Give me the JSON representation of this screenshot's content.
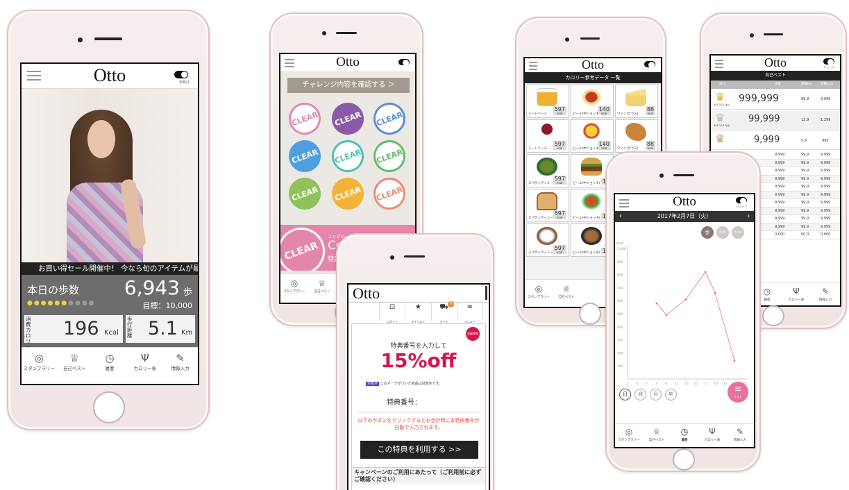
{
  "app": {
    "name": "Otto"
  },
  "phone1": {
    "step_toggle_label": "歩数計",
    "banner": "お買い得セール開催中！ 今なら旬のアイテムが最",
    "today_steps_label": "本日の歩数",
    "steps_value": "6,943",
    "steps_unit": "歩",
    "goal": "目標：10,000",
    "calorie_label": "消費カロリー",
    "calorie_value": "196",
    "calorie_unit": "Kcal",
    "distance_label": "歩行距離",
    "distance_value": "5.1",
    "distance_unit": "Km",
    "tabs": [
      "スタンプラリー",
      "自己ベスト",
      "履歴",
      "カロリー表",
      "情報入力"
    ]
  },
  "phone2": {
    "challenge_button": "チャレンジ内容を確認する ＞",
    "stamp_text": "CLEAR",
    "complete_msg": "コンプリート！おめでとうございます！",
    "complete_prefix": "Co",
    "complete_sub": "特典",
    "tabs": [
      "スタンプラリー",
      "自己ベスト"
    ]
  },
  "phone3": {
    "menu_items": [
      "ログイン",
      "マイリスト",
      "カート",
      "メニュー"
    ],
    "cart_badge": "0",
    "coupon_lead": "特典番号を入力して",
    "coupon_badge": "会員登録",
    "discount": "15%off",
    "mark_note": "このマークがついた商品は対象外です。",
    "mark_label": "対象外",
    "code_label": "特典番号：",
    "notice": "以下のボタンをクリックするとお会計時に本特典番号が自動で入力されます。",
    "use_button": "この特典を利用する >>",
    "campaign_title": "キャンペーンのご利用にあたって（ご利用前に必ずご確認ください）"
  },
  "phone4": {
    "title": "カロリー参考データ 一覧",
    "cells": [
      {
        "name": "ミートソース",
        "value": "597",
        "unit": "kcal"
      },
      {
        "name": "ビール(中ジョッキ)",
        "value": "140",
        "unit": "kcal"
      },
      {
        "name": "ワイン(グラス)",
        "value": "88",
        "unit": "kcal"
      },
      {
        "name": "ミートソース",
        "value": "597",
        "unit": "kcal"
      },
      {
        "name": "ビール(中ジョッキ)",
        "value": "140",
        "unit": "kcal"
      },
      {
        "name": "ワイン(グラス)",
        "value": "88",
        "unit": "kcal"
      },
      {
        "name": "スパゲッティミートソース",
        "value": "597",
        "unit": "kcal"
      },
      {
        "name": "ビール(中ジョッキ)",
        "value": "14",
        "unit": "kcal"
      },
      {
        "name": "スパゲッティミートソース",
        "value": "597",
        "unit": "kcal"
      },
      {
        "name": "ビール(中ジョッキ)",
        "value": "14",
        "unit": "kcal"
      },
      {
        "name": "スパゲッティミートソース",
        "value": "597",
        "unit": "kcal"
      },
      {
        "name": "ビール(中ジョッキ)",
        "value": "14",
        "unit": "kcal"
      }
    ],
    "tabs": [
      "スタンプラリー",
      "自己ベスト"
    ]
  },
  "phone5": {
    "toggle_label": "ショップ",
    "title": "自己ベスト",
    "headers": [
      "日付",
      "歩数",
      "距離km",
      "消費kcal"
    ],
    "top": [
      {
        "date": "2017/2/1(水)",
        "steps": "999,999",
        "dist": "99.9",
        "kcal": "9,999"
      },
      {
        "date": "2017/2/15(水)",
        "steps": "99,999",
        "dist": "12.9",
        "kcal": "1,299"
      },
      {
        "date": "",
        "steps": "9,999",
        "dist": "5.9",
        "kcal": "999"
      }
    ],
    "rows": [
      {
        "steps": "9,999",
        "dist": "99.9",
        "kcal": "9,999"
      },
      {
        "steps": "9,999",
        "dist": "99.9",
        "kcal": "9,999"
      },
      {
        "steps": "9,999",
        "dist": "99.9",
        "kcal": "9,999"
      },
      {
        "steps": "9,999",
        "dist": "99.9",
        "kcal": "9,999"
      },
      {
        "steps": "9,999",
        "dist": "99.9",
        "kcal": "9,999"
      },
      {
        "steps": "9,999",
        "dist": "99.9",
        "kcal": "9,999"
      },
      {
        "steps": "9,999",
        "dist": "99.9",
        "kcal": "9,999"
      },
      {
        "steps": "9,999",
        "dist": "99.9",
        "kcal": "9,999"
      },
      {
        "steps": "9,999",
        "dist": "99.9",
        "kcal": "9,999"
      },
      {
        "steps": "9,999",
        "dist": "99.9",
        "kcal": "9,999"
      },
      {
        "steps": "0,000",
        "dist": "00.0",
        "kcal": "0,000"
      }
    ],
    "tabs": [
      "履歴",
      "カロリー表",
      "情報入力"
    ]
  },
  "phone6": {
    "toggle_label": "ショップ",
    "date": "2017年2月7日（火）",
    "metric_buttons": [
      "歩",
      "Km",
      "Kcal"
    ],
    "period_buttons": [
      "日",
      "週",
      "月",
      "年"
    ],
    "list_button": "リスト",
    "tabs": [
      "スタンプラリー",
      "自己ベスト",
      "履歴",
      "カロリー表",
      "情報入力"
    ]
  },
  "chart_data": {
    "type": "line",
    "ylabel": "kcal",
    "ylim": [
      0,
      1000
    ],
    "yticks": [
      "1,000",
      "900",
      "800",
      "700",
      "600",
      "500",
      "400",
      "300",
      "200",
      "100"
    ],
    "xticks": [
      "1",
      "3",
      "5",
      "7",
      "9",
      "11",
      "13",
      "15",
      "17",
      "19",
      "21",
      "23",
      "25"
    ],
    "x": [
      7,
      9,
      13,
      17,
      19,
      23
    ],
    "values": [
      580,
      490,
      610,
      820,
      660,
      140
    ],
    "grid": false,
    "color": "#e8718a"
  }
}
